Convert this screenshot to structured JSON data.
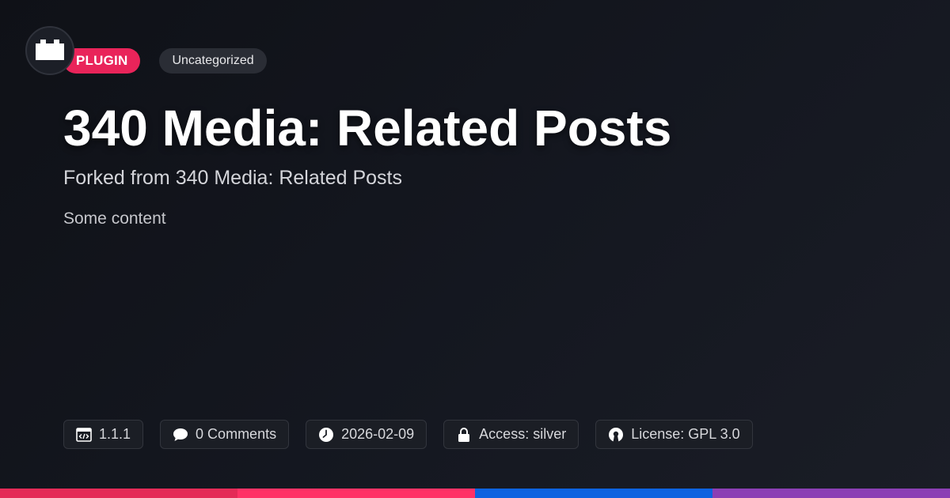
{
  "header": {
    "type_badge": "PLUGIN",
    "category_badge": "Uncategorized"
  },
  "post": {
    "title": "340 Media: Related Posts",
    "subtitle": "Forked from 340 Media: Related Posts",
    "content": "Some content"
  },
  "meta": {
    "version": {
      "icon": "code-window-icon",
      "label": "1.1.1"
    },
    "comments": {
      "icon": "comment-bubble-icon",
      "label": "0 Comments"
    },
    "date": {
      "icon": "clock-icon",
      "label": "2026-02-09"
    },
    "access": {
      "icon": "lock-icon",
      "label": "Access: silver"
    },
    "license": {
      "icon": "open-source-icon",
      "label": "License: GPL 3.0"
    }
  },
  "colors": {
    "accent": "#e9245a",
    "stripes": [
      "#e42a57",
      "#ff3266",
      "#0d63e0",
      "#8b3fb4"
    ]
  }
}
